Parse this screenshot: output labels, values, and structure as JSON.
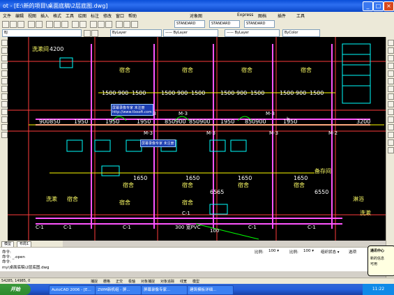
{
  "window": {
    "title": "ot - [E:\\新的项目\\桌面底稿\\2层底图.dwg]"
  },
  "menu": {
    "items": [
      "文件",
      "编辑",
      "视图",
      "插入",
      "格式",
      "工具",
      "绘图",
      "标注",
      "修改",
      "窗口",
      "帮助",
      "对象图",
      "Express",
      "图档",
      "插件",
      "工具"
    ]
  },
  "toolbar1": {
    "style1": "STANDARD",
    "style2": "STANDARD",
    "style3": "STANDARD"
  },
  "toolbar2": {
    "layer": "BJ",
    "color": "ByLayer",
    "linetype": "—— ByLayer",
    "lineweight": "—— ByLayer",
    "plotstyle": "ByColor"
  },
  "drawing": {
    "dims_top": [
      "1500",
      "900",
      "1500",
      "1500",
      "900",
      "1500",
      "1500",
      "900",
      "1500",
      "1500",
      "900",
      "1500"
    ],
    "dims_mid": [
      "900850",
      "1950",
      "1950",
      "1950",
      "850900",
      "850900",
      "1950",
      "850900",
      "1950",
      "3200"
    ],
    "dims_bottom": [
      "1650",
      "1650",
      "1650",
      "1650",
      "6565",
      "6550"
    ],
    "room_labels": [
      "宿舍",
      "宿舍",
      "宿舍",
      "宿舍",
      "宿舍",
      "宿舍",
      "宿舍",
      "宿舍",
      "宿舍",
      "宿舍",
      "宿舍"
    ],
    "labels_wash": [
      "洗漱间",
      "洗漱",
      "淋浴",
      "备存间",
      "洗漱"
    ],
    "labels_c": [
      "C-1",
      "C-1",
      "C-1",
      "C-1",
      "C-1",
      "C-1"
    ],
    "labels_m": [
      "M-3",
      "M-3",
      "M-3",
      "M-2",
      "M-3",
      "M-3",
      "M-3"
    ],
    "dim_4200": "4200",
    "note1": "300 宽PVC",
    "note2": "100",
    "label_b": "b"
  },
  "popup1": {
    "line1": "屏幕录像专家    未注册",
    "line2": "http://www.tlxsoft.com"
  },
  "popup2": {
    "text": "屏幕录像专家 未注册"
  },
  "tabs": [
    "模型",
    "布局1"
  ],
  "command": {
    "line1": "命令:",
    "line2": "命令: _.open",
    "line3": "命令:",
    "line4": "my\\桌面底稿\\2层底图.dwg",
    "scale_label": "比例:",
    "scale_value": "100 ▾",
    "scale2_label": "比例:",
    "scale2_value": "100 ▾",
    "opt": "组织状态 ▾",
    "opt2": "选项"
  },
  "status": {
    "coords": "54285, 14985, 0",
    "items": [
      "捕捉",
      "栅格",
      "正交",
      "极轴",
      "对象捕捉",
      "对象追踪",
      "线宽",
      "模型"
    ]
  },
  "balloon": {
    "title": "通讯中心",
    "line1": "新的信息",
    "line2": "可用"
  },
  "taskbar": {
    "start": "开始",
    "items": [
      "AutoCAD 2006 - [E...",
      "ZWM新机组 - 屏...",
      "屏幕录像专家...",
      "建筑模板详细..."
    ],
    "time": "11:22"
  }
}
